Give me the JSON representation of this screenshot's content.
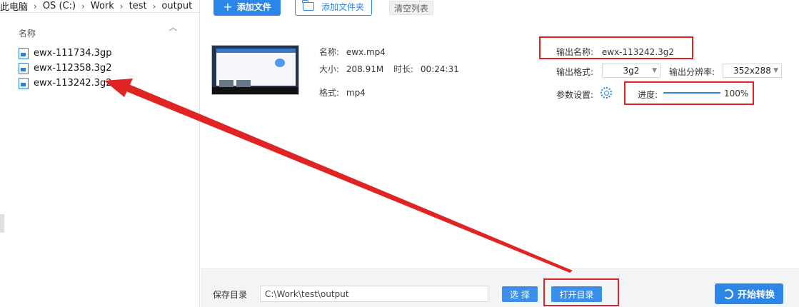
{
  "explorer": {
    "breadcrumb": [
      "此电脑",
      "OS (C:)",
      "Work",
      "test",
      "output"
    ],
    "column_header": "名称",
    "files": [
      {
        "name": "ewx-111734.3gp"
      },
      {
        "name": "ewx-112358.3g2"
      },
      {
        "name": "ewx-113242.3g2"
      }
    ]
  },
  "toolbar": {
    "add_file": "添加文件",
    "add_folder": "添加文件夹",
    "clear_list": "清空列表"
  },
  "item": {
    "name_label": "名称:",
    "name_value": "ewx.mp4",
    "size_label": "大小:",
    "size_value": "208.91M",
    "duration_label": "时长:",
    "duration_value": "00:24:31",
    "format_label": "格式:",
    "format_value": "mp4",
    "output_name_label": "输出名称:",
    "output_name_value": "ewx-113242.3g2",
    "output_format_label": "输出格式:",
    "output_format_value": "3g2",
    "resolution_label": "输出分辨率:",
    "resolution_value": "352x288",
    "params_label": "参数设置:",
    "progress_label": "进度:",
    "progress_text": "100%",
    "progress_fraction": 1.0
  },
  "bottom": {
    "save_dir_label": "保存目录",
    "save_dir_value": "C:\\Work\\test\\output",
    "choose_button": "选 择",
    "open_dir_button": "打开目录",
    "start_button": "开始转换"
  },
  "colors": {
    "accent": "#2b86e8",
    "annotation": "#e02424"
  }
}
